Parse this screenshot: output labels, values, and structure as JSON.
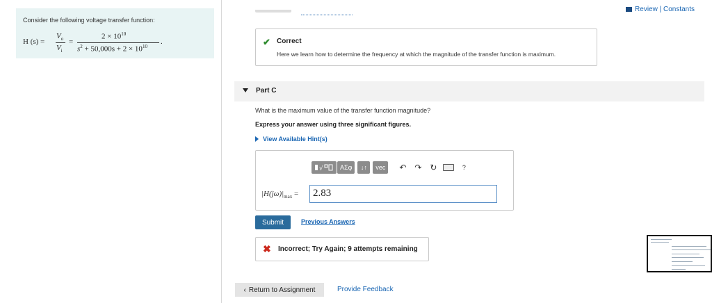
{
  "header": {
    "review_link": "Review | Constants"
  },
  "problem": {
    "intro": "Consider the following voltage transfer function:",
    "lhs": "H (s) =",
    "ratio_num": "V",
    "ratio_num_sub": "o",
    "ratio_den": "V",
    "ratio_den_sub": "i",
    "equals": "=",
    "numerator": "2 × 10",
    "numerator_exp": "10",
    "denominator_pre": "s",
    "denominator_pre_exp": "2",
    "denominator_mid": " + 50,000s + 2 × 10",
    "denominator_exp": "10",
    "period": "."
  },
  "previous_part": {
    "status_title": "Correct",
    "status_message": "Here we learn how to determine the frequency at which the magnitude of the transfer function is maximum."
  },
  "part_c": {
    "label": "Part C",
    "question": "What is the maximum value of the transfer function magnitude?",
    "instruction": "Express your answer using three significant figures.",
    "hints_link": "View Available Hint(s)",
    "toolbar": {
      "templates_icon": "templates-icon",
      "greek_label": "ΑΣφ",
      "arrows_label": "↓↑",
      "vec_label": "vec",
      "undo_icon": "undo-icon",
      "redo_icon": "redo-icon",
      "reset_icon": "reset-icon",
      "keyboard_icon": "keyboard-icon",
      "help_label": "?"
    },
    "answer_label_main": "|H(jω)|",
    "answer_label_sub": "max",
    "answer_label_eq": "=",
    "answer_value": "2.83",
    "submit_label": "Submit",
    "previous_answers_label": "Previous Answers",
    "feedback_status": "Incorrect; Try Again; 9 attempts remaining"
  },
  "footer": {
    "return_label": "Return to Assignment",
    "feedback_label": "Provide Feedback"
  },
  "colors": {
    "link": "#1a66b3",
    "correct": "#2e8b2e",
    "incorrect": "#cc2a1e",
    "submit_bg": "#2a6b9c",
    "problem_bg": "#e8f4f4"
  }
}
